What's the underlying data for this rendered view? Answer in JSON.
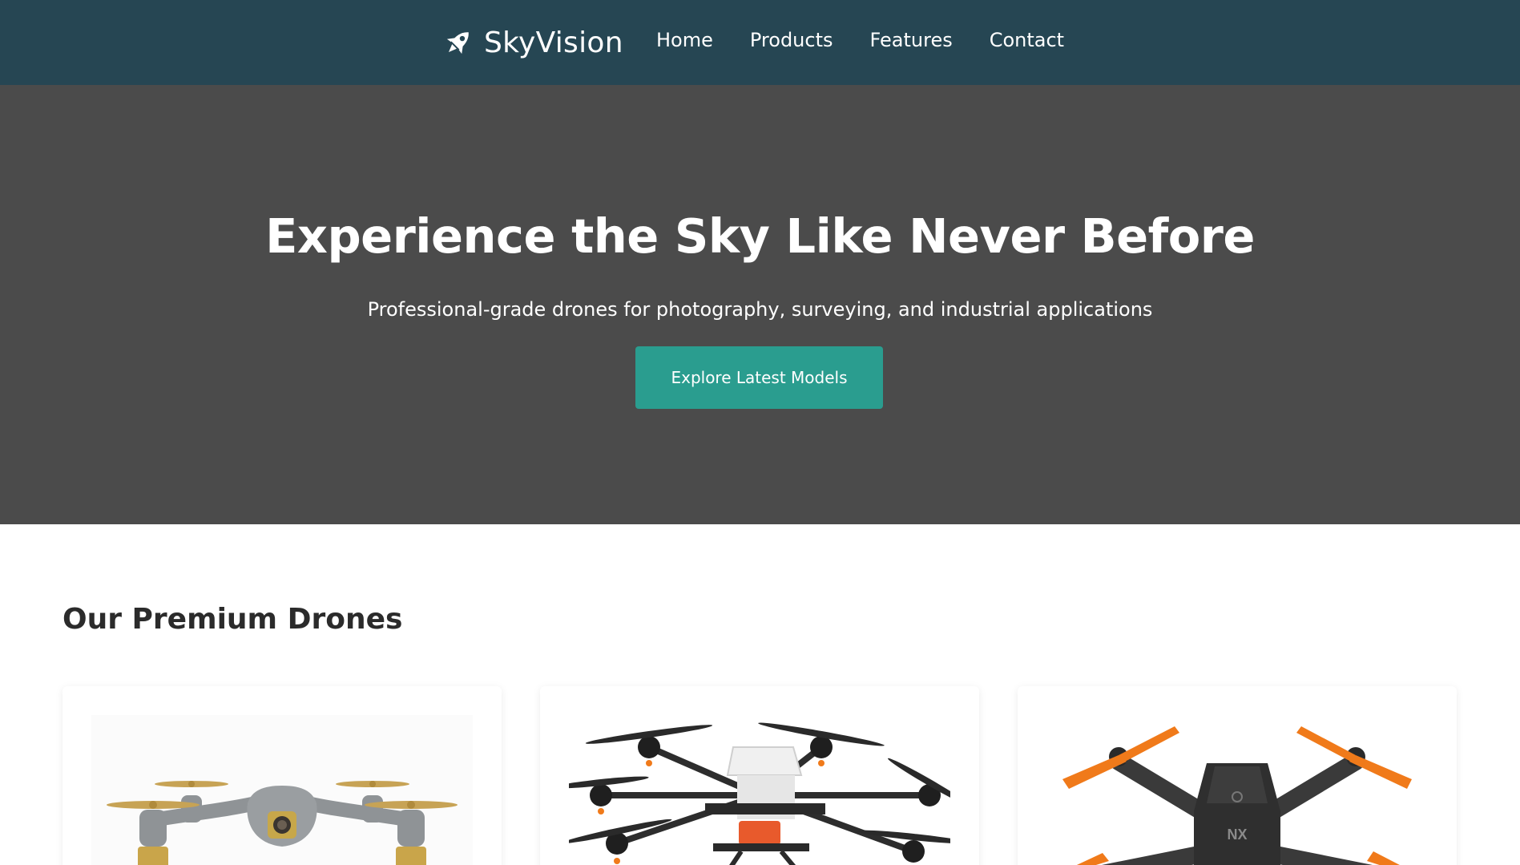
{
  "header": {
    "brand_name": "SkyVision",
    "brand_icon": "rocket-icon",
    "nav": [
      {
        "label": "Home"
      },
      {
        "label": "Products"
      },
      {
        "label": "Features"
      },
      {
        "label": "Contact"
      }
    ]
  },
  "hero": {
    "title": "Experience the Sky Like Never Before",
    "subtitle": "Professional-grade drones for photography, surveying, and industrial applications",
    "cta_label": "Explore Latest Models"
  },
  "products": {
    "section_title": "Our Premium Drones",
    "cards": [
      {
        "image": "silver-gold-quadcopter-drone-image"
      },
      {
        "image": "agricultural-hexacopter-drone-image"
      },
      {
        "image": "black-orange-foldable-drone-image"
      }
    ]
  },
  "colors": {
    "header_bg": "#264653",
    "hero_bg": "#4b4b4b",
    "accent": "#2a9d8f",
    "drone_orange": "#f07a1a"
  }
}
